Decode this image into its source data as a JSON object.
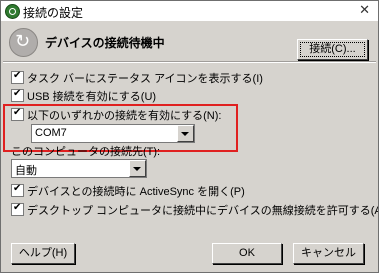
{
  "window": {
    "title": "接続の設定"
  },
  "header": {
    "title": "デバイスの接続待機中",
    "connect_button": "接続(C)..."
  },
  "options": [
    {
      "label": "タスク バーにステータス アイコンを表示する(I)",
      "checked": true
    },
    {
      "label": "USB 接続を有効にする(U)",
      "checked": true
    },
    {
      "label": "以下のいずれかの接続を有効にする(N):",
      "checked": true
    }
  ],
  "com_select": {
    "value": "COM7"
  },
  "connect_to": {
    "label": "このコンピュータの接続先(T):",
    "value": "自動"
  },
  "more_options": [
    {
      "label": "デバイスとの接続時に ActiveSync を開く(P)",
      "checked": true
    },
    {
      "label": "デスクトップ コンピュータに接続中にデバイスの無線接続を許可する(A)",
      "checked": true
    }
  ],
  "footer": {
    "help": "ヘルプ(H)",
    "ok": "OK",
    "cancel": "キャンセル"
  },
  "colors": {
    "window_bg": "#d6d3ce",
    "highlight": "#e02020"
  }
}
